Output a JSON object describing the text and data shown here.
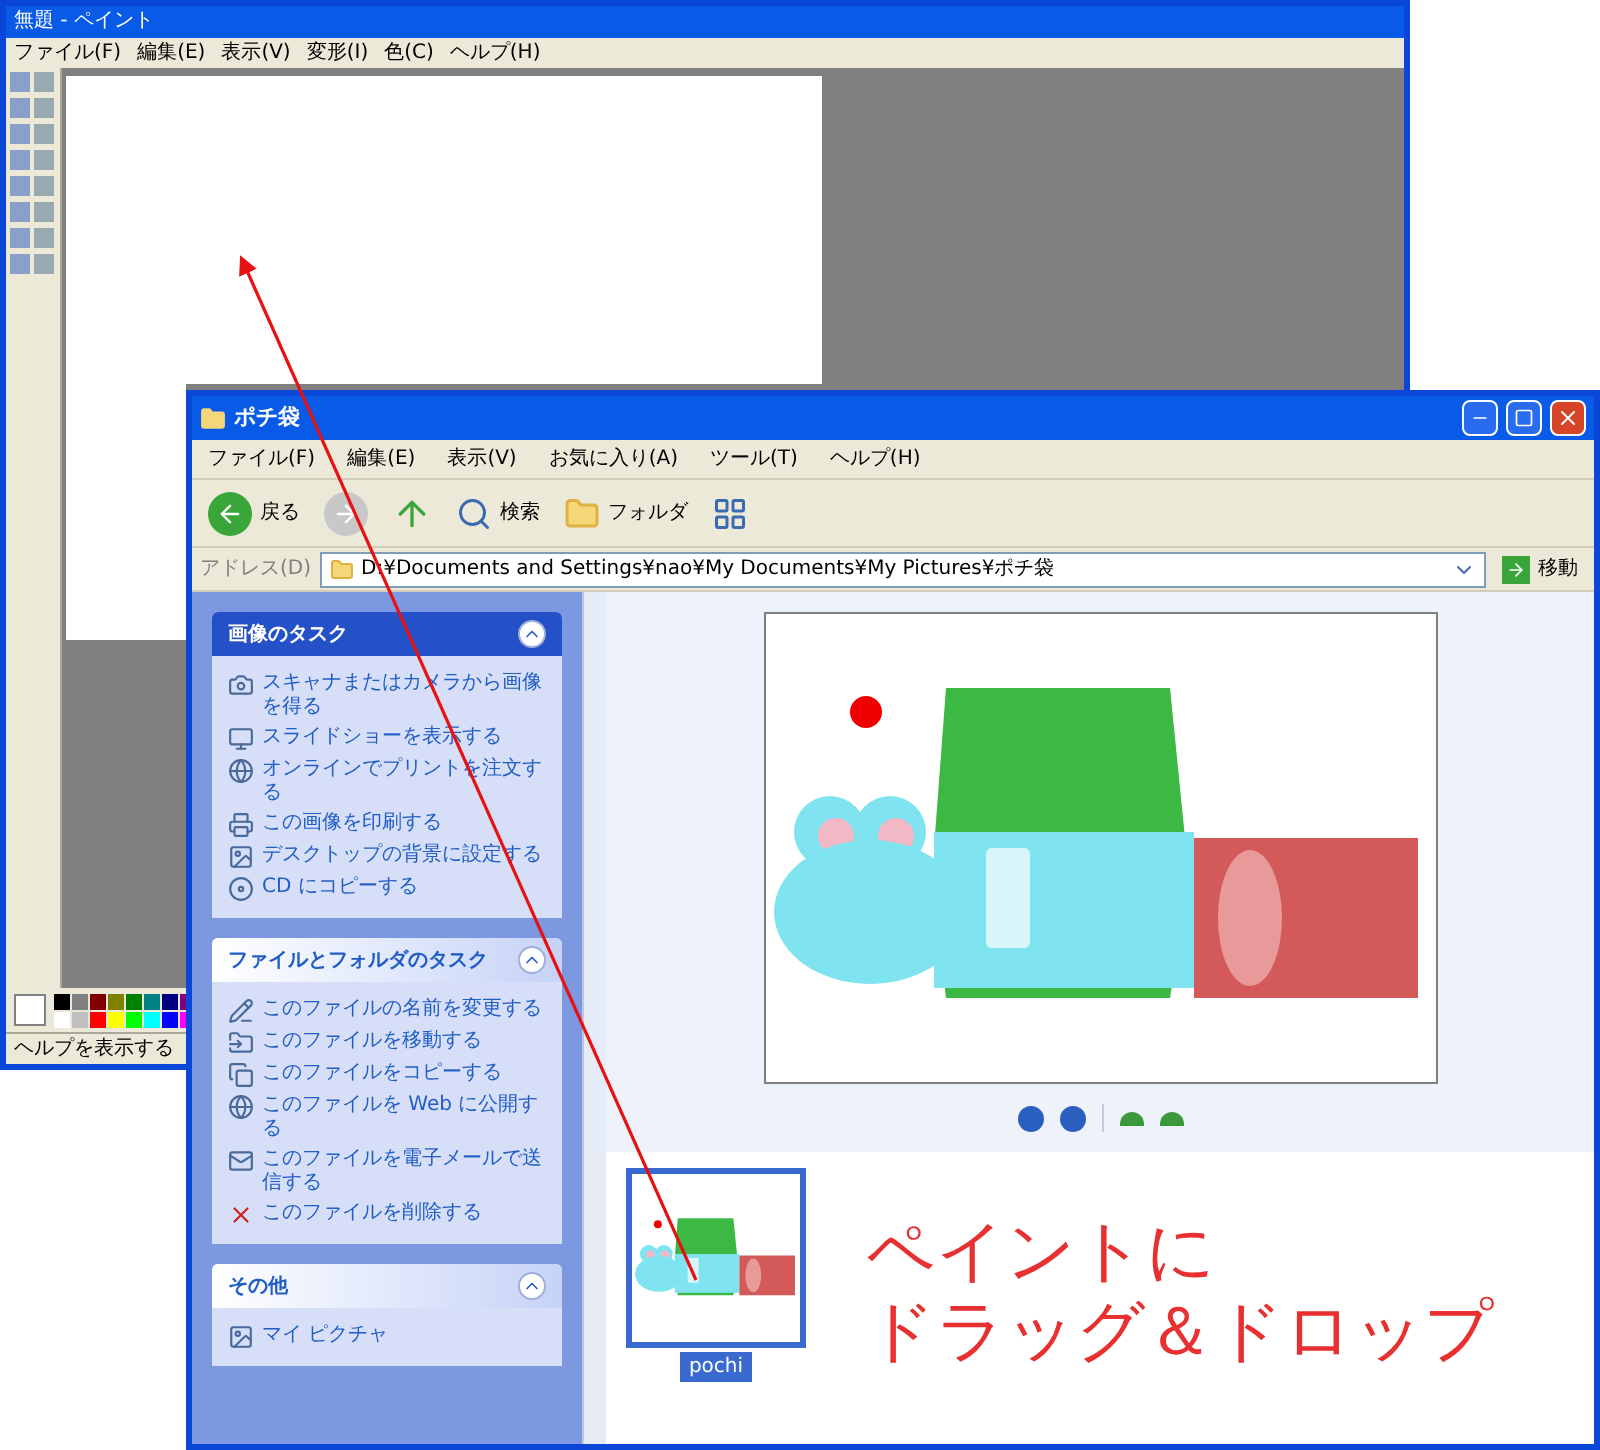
{
  "paint_window": {
    "title": "無題 - ペイント",
    "menu": [
      "ファイル(F)",
      "編集(E)",
      "表示(V)",
      "変形(I)",
      "色(C)",
      "ヘルプ(H)"
    ],
    "status_bar": "ヘルプを表示する"
  },
  "explorer_window": {
    "title": "ポチ袋",
    "menu": [
      "ファイル(F)",
      "編集(E)",
      "表示(V)",
      "お気に入り(A)",
      "ツール(T)",
      "ヘルプ(H)"
    ],
    "toolbar": {
      "back": "戻る",
      "search": "検索",
      "folders": "フォルダ"
    },
    "address": {
      "label": "アドレス(D)",
      "value": "D:¥Documents and Settings¥nao¥My Documents¥My Pictures¥ポチ袋",
      "go": "移動"
    },
    "task_panes": [
      {
        "title": "画像のタスク",
        "expanded": true,
        "items": [
          "スキャナまたはカメラから画像を得る",
          "スライドショーを表示する",
          "オンラインでプリントを注文する",
          "この画像を印刷する",
          "デスクトップの背景に設定する",
          "CD にコピーする"
        ]
      },
      {
        "title": "ファイルとフォルダのタスク",
        "expanded": true,
        "items": [
          "このファイルの名前を変更する",
          "このファイルを移動する",
          "このファイルをコピーする",
          "このファイルを Web に公開する",
          "このファイルを電子メールで送信する",
          "このファイルを削除する"
        ]
      },
      {
        "title": "その他",
        "expanded": true,
        "items": [
          "マイ ピクチャ"
        ]
      }
    ],
    "thumbnails": [
      {
        "label": "pochi",
        "selected": true
      }
    ]
  },
  "annotation": {
    "lines": [
      "ペイントに",
      "ドラッグ＆ドロップ"
    ]
  }
}
